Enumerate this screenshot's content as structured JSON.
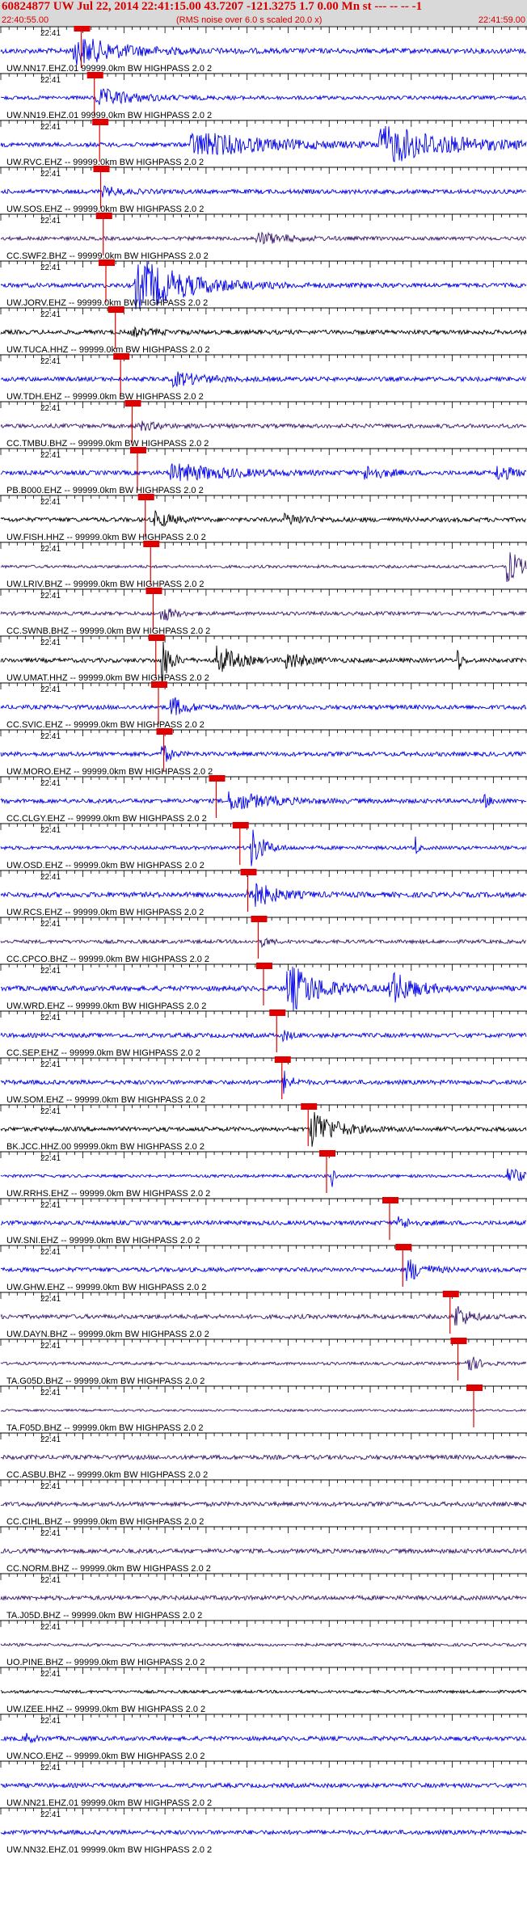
{
  "header": {
    "title": "60824877 UW Jul 22, 2014 22:41:15.00   43.7207 -121.3275  1.7 0.00 Mn st --- -- --  -1",
    "subtitle": "(RMS noise over 6.0 s scaled 20.0 x)",
    "start_time": "22:40:55.00",
    "end_time": "22:41:59.00"
  },
  "chart_data": {
    "type": "line",
    "title": "60824877 UW Jul 22, 2014 22:41:15.00   43.7207 -121.3275  1.7 0.00 Mn st --- -- --  -1",
    "subtitle": "(RMS noise over 6.0 s scaled 20.0 x)",
    "x_range": [
      "22:40:55.00",
      "22:41:59.00"
    ],
    "tick_label": "22:41",
    "colors": {
      "blue": "#0000e6",
      "black": "#000000",
      "purple": "#3a1a6e",
      "pick": "#e00000",
      "grid": "#000000"
    },
    "traces": [
      {
        "label": "UW.NN17.EHZ.01 99999.0km BW  HIGHPASS  2.0  2",
        "color": "blue",
        "amp": 0.35,
        "pick": 0.153,
        "bursts": [
          [
            0.16,
            0.12,
            1.6
          ]
        ]
      },
      {
        "label": "UW.NN19.EHZ.01 99999.0km BW  HIGHPASS  2.0  2",
        "color": "blue",
        "amp": 0.25,
        "pick": 0.178,
        "bursts": [
          [
            0.2,
            0.1,
            1.0
          ]
        ]
      },
      {
        "label": "UW.RVC.EHZ -- 99999.0km BW  HIGHPASS  2.0  2",
        "color": "blue",
        "amp": 0.3,
        "pick": 0.188,
        "bursts": [
          [
            0.4,
            0.2,
            1.4
          ],
          [
            0.75,
            0.18,
            2.2
          ]
        ]
      },
      {
        "label": "UW.SOS.EHZ -- 99999.0km BW  HIGHPASS  2.0  2",
        "color": "blue",
        "amp": 0.3,
        "pick": 0.19,
        "bursts": [
          [
            0.2,
            0.05,
            0.5
          ]
        ]
      },
      {
        "label": "CC.SWF2.BHZ -- 99999.0km BW  HIGHPASS  2.0  2",
        "color": "purple",
        "amp": 0.25,
        "pick": 0.195,
        "bursts": [
          [
            0.5,
            0.08,
            0.7
          ]
        ]
      },
      {
        "label": "UW.JORV.EHZ -- 99999.0km BW  HIGHPASS  2.0  2",
        "color": "blue",
        "amp": 0.3,
        "pick": 0.2,
        "bursts": [
          [
            0.28,
            0.13,
            3.0
          ]
        ]
      },
      {
        "label": "UW.TUCA.HHZ -- 99999.0km BW  HIGHPASS  2.0  2",
        "color": "black",
        "amp": 0.3,
        "pick": 0.218,
        "bursts": [
          [
            0.26,
            0.06,
            0.4
          ]
        ]
      },
      {
        "label": "UW.TDH.EHZ -- 99999.0km BW  HIGHPASS  2.0  2",
        "color": "blue",
        "amp": 0.3,
        "pick": 0.228,
        "bursts": [
          [
            0.34,
            0.08,
            0.8
          ]
        ]
      },
      {
        "label": "CC.TMBU.BHZ -- 99999.0km BW  HIGHPASS  2.0  2",
        "color": "purple",
        "amp": 0.28,
        "pick": 0.25,
        "bursts": [
          [
            0.27,
            0.05,
            0.5
          ]
        ]
      },
      {
        "label": "PB.B000.EHZ -- 99999.0km BW  HIGHPASS  2.0  2",
        "color": "blue",
        "amp": 0.3,
        "pick": 0.26,
        "bursts": [
          [
            0.35,
            0.15,
            1.0
          ],
          [
            0.7,
            0.05,
            0.8
          ],
          [
            0.95,
            0.04,
            1.0
          ]
        ]
      },
      {
        "label": "UW.FISH.HHZ -- 99999.0km BW  HIGHPASS  2.0  2",
        "color": "black",
        "amp": 0.3,
        "pick": 0.275,
        "bursts": [
          [
            0.3,
            0.04,
            1.0
          ],
          [
            0.55,
            0.06,
            0.6
          ]
        ]
      },
      {
        "label": "UW.LRIV.BHZ -- 99999.0km BW  HIGHPASS  2.0  2",
        "color": "purple",
        "amp": 0.2,
        "pick": 0.285,
        "bursts": [
          [
            0.97,
            0.04,
            2.0
          ]
        ]
      },
      {
        "label": "CC.SWNB.BHZ -- 99999.0km BW  HIGHPASS  2.0  2",
        "color": "purple",
        "amp": 0.25,
        "pick": 0.29,
        "bursts": [
          [
            0.31,
            0.03,
            1.0
          ]
        ]
      },
      {
        "label": "UW.UMAT.HHZ -- 99999.0km BW  HIGHPASS  2.0  2",
        "color": "black",
        "amp": 0.3,
        "pick": 0.295,
        "bursts": [
          [
            0.31,
            0.02,
            3.0
          ],
          [
            0.42,
            0.05,
            1.8
          ],
          [
            0.55,
            0.05,
            1.0
          ],
          [
            0.87,
            0.01,
            1.6
          ]
        ]
      },
      {
        "label": "CC.SVIC.EHZ -- 99999.0km BW  HIGHPASS  2.0  2",
        "color": "blue",
        "amp": 0.3,
        "pick": 0.3,
        "bursts": [
          [
            0.33,
            0.04,
            1.2
          ]
        ]
      },
      {
        "label": "UW.MORO.EHZ -- 99999.0km BW  HIGHPASS  2.0  2",
        "color": "blue",
        "amp": 0.3,
        "pick": 0.31,
        "bursts": [
          [
            0.31,
            0.02,
            1.2
          ]
        ]
      },
      {
        "label": "CC.CLGY.EHZ -- 99999.0km BW  HIGHPASS  2.0  2",
        "color": "blue",
        "amp": 0.3,
        "pick": 0.41,
        "bursts": [
          [
            0.45,
            0.1,
            1.1
          ],
          [
            0.92,
            0.02,
            0.8
          ]
        ]
      },
      {
        "label": "UW.OSD.EHZ -- 99999.0km BW  HIGHPASS  2.0  2",
        "color": "blue",
        "amp": 0.25,
        "pick": 0.455,
        "bursts": [
          [
            0.48,
            0.03,
            2.6
          ],
          [
            0.79,
            0.005,
            1.8
          ]
        ]
      },
      {
        "label": "UW.RCS.EHZ -- 99999.0km BW  HIGHPASS  2.0  2",
        "color": "blue",
        "amp": 0.35,
        "pick": 0.47,
        "bursts": [
          [
            0.48,
            0.06,
            1.8
          ]
        ]
      },
      {
        "label": "CC.CPCO.BHZ -- 99999.0km BW  HIGHPASS  2.0  2",
        "color": "purple",
        "amp": 0.25,
        "pick": 0.49,
        "bursts": [
          [
            0.5,
            0.02,
            0.6
          ]
        ]
      },
      {
        "label": "UW.WRD.EHZ -- 99999.0km BW  HIGHPASS  2.0  2",
        "color": "blue",
        "amp": 0.35,
        "pick": 0.5,
        "bursts": [
          [
            0.56,
            0.08,
            2.8
          ],
          [
            0.75,
            0.06,
            2.0
          ]
        ]
      },
      {
        "label": "CC.SEP.EHZ -- 99999.0km BW  HIGHPASS  2.0  2",
        "color": "blue",
        "amp": 0.3,
        "pick": 0.525,
        "bursts": [
          [
            0.54,
            0.02,
            0.6
          ]
        ]
      },
      {
        "label": "UW.SOM.EHZ -- 99999.0km BW  HIGHPASS  2.0  2",
        "color": "blue",
        "amp": 0.3,
        "pick": 0.535,
        "bursts": [
          [
            0.54,
            0.02,
            1.4
          ]
        ]
      },
      {
        "label": "BK.JCC.HHZ.00 99999.0km BW  HIGHPASS  2.0  2",
        "color": "black",
        "amp": 0.3,
        "pick": 0.585,
        "bursts": [
          [
            0.6,
            0.06,
            2.4
          ]
        ]
      },
      {
        "label": "UW.RRHS.EHZ -- 99999.0km BW  HIGHPASS  2.0  2",
        "color": "blue",
        "amp": 0.2,
        "pick": 0.62,
        "bursts": [
          [
            0.63,
            0.005,
            3.0
          ],
          [
            0.97,
            0.03,
            1.4
          ]
        ]
      },
      {
        "label": "UW.SNI.EHZ -- 99999.0km BW  HIGHPASS  2.0  2",
        "color": "blue",
        "amp": 0.3,
        "pick": 0.74,
        "bursts": [
          [
            0.76,
            0.03,
            0.8
          ]
        ]
      },
      {
        "label": "UW.GHW.EHZ -- 99999.0km BW  HIGHPASS  2.0  2",
        "color": "blue",
        "amp": 0.3,
        "pick": 0.765,
        "bursts": [
          [
            0.78,
            0.04,
            1.4
          ]
        ]
      },
      {
        "label": "UW.DAYN.BHZ -- 99999.0km BW  HIGHPASS  2.0  2",
        "color": "purple",
        "amp": 0.3,
        "pick": 0.855,
        "bursts": [
          [
            0.87,
            0.03,
            1.6
          ]
        ]
      },
      {
        "label": "TA.G05D.BHZ -- 99999.0km BW  HIGHPASS  2.0  2",
        "color": "purple",
        "amp": 0.2,
        "pick": 0.87,
        "bursts": [
          [
            0.89,
            0.03,
            1.2
          ]
        ]
      },
      {
        "label": "TA.F05D.BHZ -- 99999.0km BW  HIGHPASS  2.0  2",
        "color": "purple",
        "amp": 0.15,
        "pick": 0.9,
        "bursts": []
      },
      {
        "label": "CC.ASBU.BHZ -- 99999.0km BW  HIGHPASS  2.0  2",
        "color": "purple",
        "amp": 0.3,
        "pick": null,
        "bursts": []
      },
      {
        "label": "CC.CIHL.BHZ -- 99999.0km BW  HIGHPASS  2.0  2",
        "color": "purple",
        "amp": 0.3,
        "pick": null,
        "bursts": []
      },
      {
        "label": "CC.NORM.BHZ -- 99999.0km BW  HIGHPASS  2.0  2",
        "color": "purple",
        "amp": 0.3,
        "pick": null,
        "bursts": []
      },
      {
        "label": "TA.J05D.BHZ -- 99999.0km BW  HIGHPASS  2.0  2",
        "color": "purple",
        "amp": 0.3,
        "pick": null,
        "bursts": []
      },
      {
        "label": "UO.PINE.BHZ -- 99999.0km BW  HIGHPASS  2.0  2",
        "color": "purple",
        "amp": 0.2,
        "pick": null,
        "bursts": []
      },
      {
        "label": "UW.IZEE.HHZ -- 99999.0km BW  HIGHPASS  2.0  2",
        "color": "black",
        "amp": 0.2,
        "pick": null,
        "bursts": []
      },
      {
        "label": "UW.NCO.EHZ -- 99999.0km BW  HIGHPASS  2.0  2",
        "color": "blue",
        "amp": 0.3,
        "pick": null,
        "bursts": [
          [
            0.05,
            0.02,
            0.6
          ]
        ]
      },
      {
        "label": "UW.NN21.EHZ.01 99999.0km BW  HIGHPASS  2.0  2",
        "color": "blue",
        "amp": 0.3,
        "pick": null,
        "bursts": []
      },
      {
        "label": "UW.NN32.EHZ.01 99999.0km BW  HIGHPASS  2.0  2",
        "color": "blue",
        "amp": 0.3,
        "pick": null,
        "bursts": []
      }
    ]
  }
}
